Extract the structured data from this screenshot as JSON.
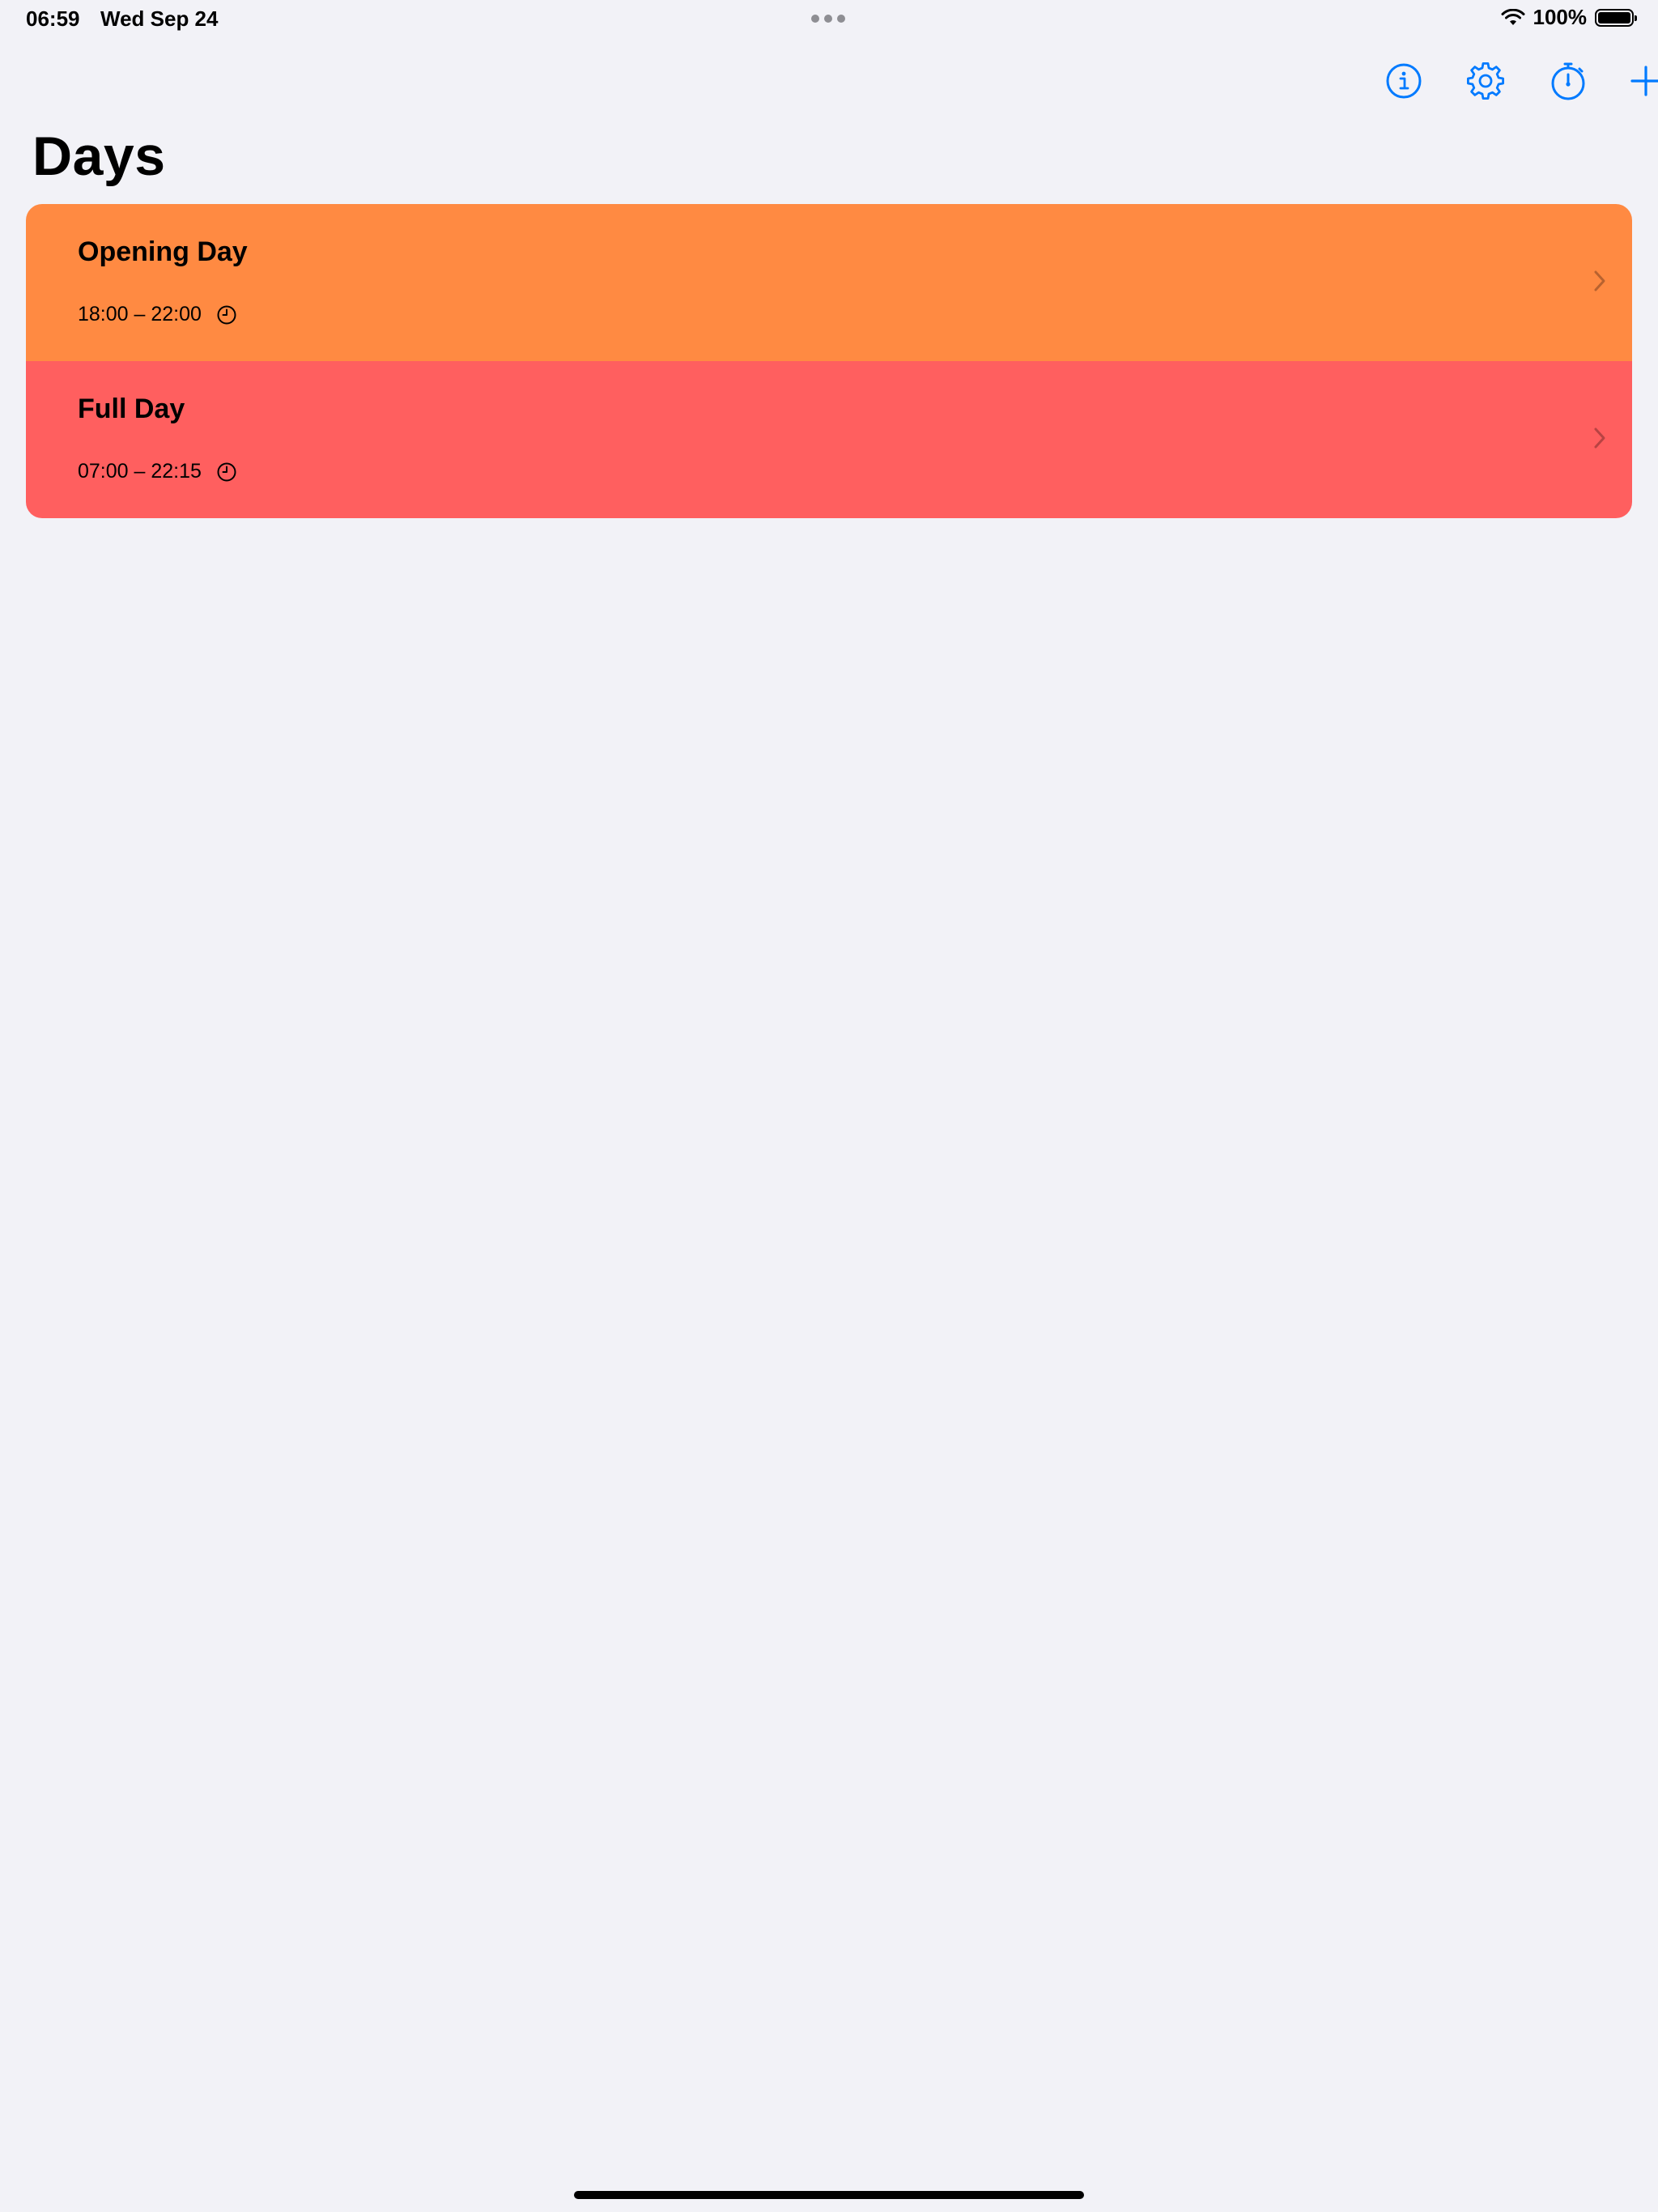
{
  "status_bar": {
    "time": "06:59",
    "date": "Wed Sep 24",
    "battery": "100%"
  },
  "toolbar": {
    "icons": [
      "info-icon",
      "gear-icon",
      "timer-icon",
      "plus-icon"
    ],
    "accent_color": "#007aff"
  },
  "page": {
    "title": "Days"
  },
  "days": [
    {
      "name": "Opening Day",
      "time": "18:00 – 22:00",
      "color": "#ff8a42"
    },
    {
      "name": "Full Day",
      "time": "07:00 – 22:15",
      "color": "#ff5f5f"
    }
  ]
}
